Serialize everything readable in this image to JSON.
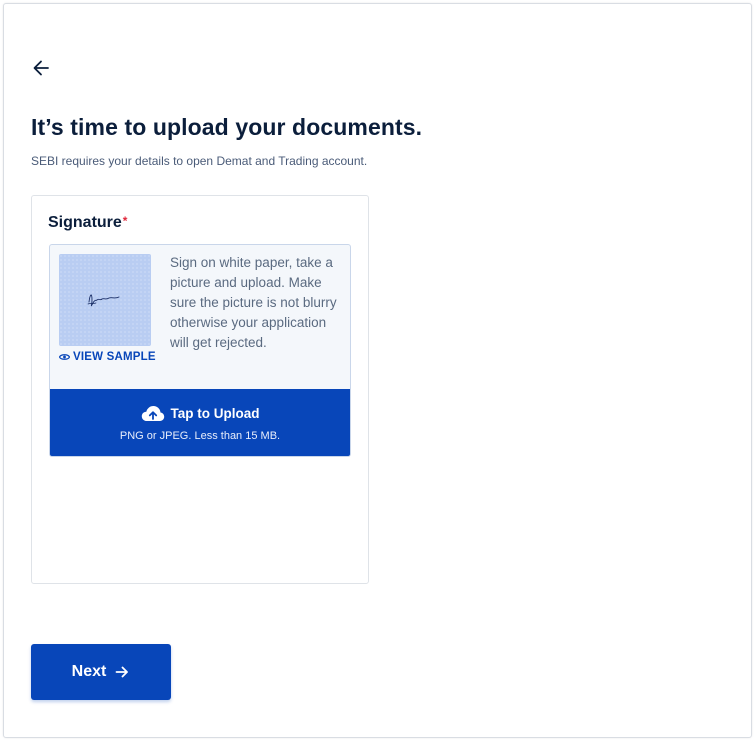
{
  "header": {
    "back_icon": "arrow-left-icon",
    "title": "It’s time to upload your documents.",
    "subtitle": "SEBI requires your details to open Demat and Trading account."
  },
  "document": {
    "label": "Signature",
    "required_mark": "*",
    "sample_link": "VIEW SAMPLE",
    "sample_icon": "eye-icon",
    "instructions": "Sign on white paper, take a picture and upload. Make sure the picture is not blurry otherwise your application will get rejected.",
    "upload_label": "Tap to Upload",
    "upload_icon": "cloud-upload-icon",
    "upload_hint": "PNG or JPEG. Less than 15 MB."
  },
  "footer": {
    "next_label": "Next",
    "next_icon": "arrow-right-icon"
  },
  "colors": {
    "primary": "#0846b9",
    "heading": "#0b1e3b",
    "required": "#e0283b"
  }
}
